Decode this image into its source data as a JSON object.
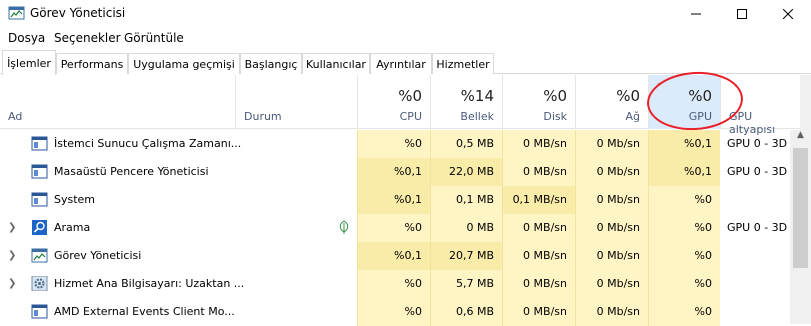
{
  "window": {
    "title": "Görev Yöneticisi"
  },
  "menu": [
    {
      "label": "Dosya"
    },
    {
      "label": "Seçenekler"
    },
    {
      "label": "Görüntüle"
    }
  ],
  "tabs": [
    {
      "label": "İşlemler",
      "active": true
    },
    {
      "label": "Performans"
    },
    {
      "label": "Uygulama geçmişi"
    },
    {
      "label": "Başlangıç"
    },
    {
      "label": "Kullanıcılar"
    },
    {
      "label": "Ayrıntılar"
    },
    {
      "label": "Hizmetler"
    }
  ],
  "columns": {
    "name": {
      "label": "Ad"
    },
    "status": {
      "label": "Durum"
    },
    "cpu": {
      "label": "CPU",
      "total": "%0"
    },
    "memory": {
      "label": "Bellek",
      "total": "%14"
    },
    "disk": {
      "label": "Disk",
      "total": "%0"
    },
    "network": {
      "label": "Ağ",
      "total": "%0"
    },
    "gpu": {
      "label": "GPU",
      "total": "%0"
    },
    "gpu_engine": {
      "label": "GPU altyapısı"
    }
  },
  "rows": [
    {
      "name": "İstemci Sunucu Çalışma Zamanı...",
      "icon": "window-icon",
      "expandable": false,
      "cpu": "%0",
      "memory": "0,5 MB",
      "disk": "0 MB/sn",
      "network": "0 Mb/sn",
      "gpu": "%0,1",
      "gpu_engine": "GPU 0 - 3D"
    },
    {
      "name": "Masaüstü Pencere Yöneticisi",
      "icon": "window-icon",
      "expandable": false,
      "cpu": "%0,1",
      "memory": "22,0 MB",
      "disk": "0 MB/sn",
      "network": "0 Mb/sn",
      "gpu": "%0,1",
      "gpu_engine": "GPU 0 - 3D"
    },
    {
      "name": "System",
      "icon": "window-icon",
      "expandable": false,
      "cpu": "%0,1",
      "memory": "0,1 MB",
      "disk": "0,1 MB/sn",
      "network": "0 Mb/sn",
      "gpu": "%0",
      "gpu_engine": ""
    },
    {
      "name": "Arama",
      "icon": "search-icon",
      "expandable": true,
      "suspended": true,
      "cpu": "%0",
      "memory": "0 MB",
      "disk": "0 MB/sn",
      "network": "0 Mb/sn",
      "gpu": "%0",
      "gpu_engine": "GPU 0 - 3D"
    },
    {
      "name": "Görev Yöneticisi",
      "icon": "task-manager-icon",
      "expandable": true,
      "cpu": "%0,1",
      "memory": "20,7 MB",
      "disk": "0 MB/sn",
      "network": "0 Mb/sn",
      "gpu": "%0",
      "gpu_engine": ""
    },
    {
      "name": "Hizmet Ana Bilgisayarı: Uzaktan ...",
      "icon": "gear-icon",
      "expandable": true,
      "cpu": "%0",
      "memory": "5,7 MB",
      "disk": "0 MB/sn",
      "network": "0 Mb/sn",
      "gpu": "%0",
      "gpu_engine": ""
    },
    {
      "name": "AMD External Events Client Mo...",
      "icon": "window-icon",
      "expandable": false,
      "cpu": "%0",
      "memory": "0,6 MB",
      "disk": "0 MB/sn",
      "network": "0 Mb/sn",
      "gpu": "%0",
      "gpu_engine": ""
    }
  ],
  "colors": {
    "heat_light": "#fff4c4",
    "heat_medium": "#f9eca8",
    "sorted_header": "#dcebfb",
    "annotation": "#e8202a"
  }
}
